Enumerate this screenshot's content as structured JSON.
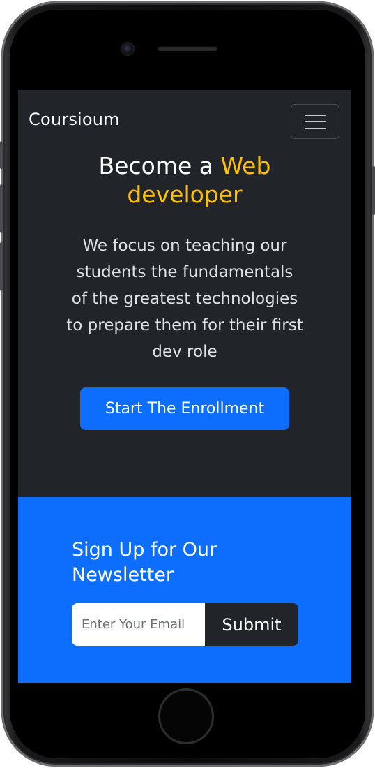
{
  "navbar": {
    "brand": "Coursioum",
    "toggler_icon": "hamburger-menu-icon"
  },
  "hero": {
    "title_part1": "Become a ",
    "title_accent": "Web",
    "title_part2": "developer",
    "description": "We focus on teaching our students the fundamentals of the greatest technologies to prepare them for their first dev role",
    "cta_label": "Start The Enrollment"
  },
  "newsletter": {
    "title": "Sign Up for Our Newsletter",
    "email_placeholder": "Enter Your Email",
    "email_value": "",
    "submit_label": "Submit"
  },
  "colors": {
    "dark_bg": "#212529",
    "accent_yellow": "#ffc107",
    "primary_blue": "#0d6efd"
  }
}
